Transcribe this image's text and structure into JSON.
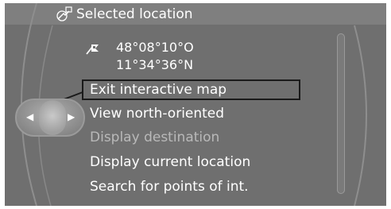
{
  "header": {
    "title": "Selected location",
    "icon": "map-pin-icon"
  },
  "location": {
    "icon": "destination-flag-icon",
    "latitude": "48°08°10°O",
    "longitude": "11°34°36°N"
  },
  "menu": {
    "items": [
      {
        "label": "Exit interactive map",
        "enabled": true,
        "selected": true
      },
      {
        "label": "View north-oriented",
        "enabled": true,
        "selected": false
      },
      {
        "label": "Display destination",
        "enabled": false,
        "selected": false
      },
      {
        "label": "Display current location",
        "enabled": true,
        "selected": false
      },
      {
        "label": "Search for points of int.",
        "enabled": true,
        "selected": false
      }
    ]
  },
  "controller": {
    "left_icon": "arrow-left-icon",
    "right_icon": "arrow-right-icon"
  },
  "colors": {
    "background": "#6f6f6f",
    "header": "#7f7f7f",
    "text": "#ffffff",
    "disabled_text": "#b9b9b9",
    "selection_border": "#1a1a1a"
  }
}
